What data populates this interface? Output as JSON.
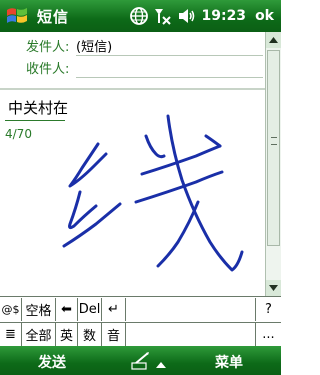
{
  "topbar": {
    "title": "短信",
    "time": "19:23",
    "ok_label": "ok",
    "icons": [
      "windows-start-icon",
      "globe-icon",
      "no-signal-icon",
      "speaker-icon"
    ]
  },
  "header": {
    "from_label": "发件人:",
    "from_value": "(短信)",
    "to_label": "收件人:",
    "to_value": ""
  },
  "body": {
    "text": "中关村在",
    "char_count": "4/70"
  },
  "keyboard": {
    "row1": [
      "@$",
      "空格",
      "⬅",
      "Del",
      "↵",
      "?"
    ],
    "row2": [
      "≣",
      "全部",
      "英",
      "数",
      "音",
      "..."
    ]
  },
  "softkeys": {
    "left": "发送",
    "right": "菜单"
  },
  "colors": {
    "bar_green": "#0d6a18",
    "label_green": "#2a7a2a",
    "ink_blue": "#1a2fa8"
  }
}
